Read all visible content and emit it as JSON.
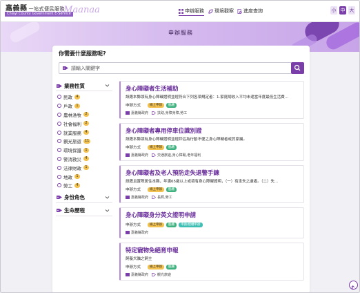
{
  "header": {
    "logo_title": "嘉義縣",
    "logo_subtitle": "一站式便民服務",
    "logo_en": "Chiayi County Government E-Service",
    "logo_script": "iMaanaa",
    "nav": [
      {
        "label": "申辦服務",
        "active": true,
        "icon": "grid-icon"
      },
      {
        "label": "環境觀察",
        "active": false,
        "icon": "leaf-icon"
      },
      {
        "label": "進度查詢",
        "active": false,
        "icon": "search-doc-icon"
      }
    ],
    "font_size": {
      "small": "小",
      "medium": "中",
      "large": "大"
    }
  },
  "banner": {
    "title": "申辦服務"
  },
  "search": {
    "question": "你需要什麼服務呢?",
    "placeholder": "請輸入關鍵字"
  },
  "sidebar": {
    "sections": [
      {
        "label": "業務性質",
        "expanded": true,
        "options": [
          {
            "label": "民政",
            "count": "4"
          },
          {
            "label": "戶政",
            "count": "1"
          },
          {
            "label": "農林漁牧",
            "count": "2"
          },
          {
            "label": "社會福利",
            "count": "2"
          },
          {
            "label": "就業服務",
            "count": "4"
          },
          {
            "label": "觀光旅遊",
            "count": "11"
          },
          {
            "label": "環境保護",
            "count": "1"
          },
          {
            "label": "警消救災",
            "count": "4"
          },
          {
            "label": "法律財政",
            "count": "1"
          },
          {
            "label": "地政",
            "count": "1"
          },
          {
            "label": "勞工",
            "count": "4"
          }
        ]
      },
      {
        "label": "身份角色",
        "expanded": false,
        "options": []
      },
      {
        "label": "生命歷程",
        "expanded": false,
        "options": []
      }
    ]
  },
  "results": [
    {
      "title": "身心障礙者生活補助",
      "desc": "設籍本縣領有身心障礙證明並經符合下列各項規定者：1.家庭總收入平均未達當年度最低生活費...",
      "method_label": "申辦方式",
      "chips": [
        {
          "text": "線上申辦",
          "color": "y"
        },
        {
          "text": "臨櫃",
          "color": "g"
        }
      ],
      "agency": "嘉義縣政府",
      "tags": "扶助,身障身障,勞工"
    },
    {
      "title": "身心障礙者專用停車位識別證",
      "desc": "設籍本縣領有身心障礙證明並經評估為行動不便之身心障礙者或其家屬。",
      "method_label": "申辦方式",
      "chips": [
        {
          "text": "線上申辦",
          "color": "y"
        },
        {
          "text": "臨櫃",
          "color": "g"
        }
      ],
      "agency": "嘉義縣政府",
      "tags": "交通旅遊,身心障礙,老年福利"
    },
    {
      "title": "身心障礙者及老人預防走失退警手鍊",
      "desc": "設籍且實際居住本縣，年滿65歲以上或領有身心障礙證明，（一）有走失之虞者。（二）失...",
      "method_label": "申辦方式",
      "chips": [
        {
          "text": "線上申辦",
          "color": "y"
        },
        {
          "text": "臨櫃",
          "color": "g"
        }
      ],
      "agency": "嘉義縣政府",
      "tags": "長照,勞工"
    },
    {
      "title": "身心障礙身分英文證明申請",
      "desc": "",
      "method_label": "申辦方式",
      "chips": [
        {
          "text": "線上申辦",
          "color": "y"
        },
        {
          "text": "臨櫃",
          "color": "g"
        },
        {
          "text": "申請/授權申辦",
          "color": "t"
        }
      ],
      "agency": "嘉義縣政府",
      "tags": ""
    },
    {
      "title": "特定寵物免絕育申報",
      "desc": "飼養犬貓之飼主",
      "method_label": "申辦方式",
      "chips": [
        {
          "text": "線上申辦",
          "color": "y"
        },
        {
          "text": "臨櫃",
          "color": "g"
        }
      ],
      "agency": "嘉義縣政府",
      "tags": "觀光旅遊"
    }
  ],
  "colors": {
    "primary": "#7a3ea8",
    "badge": "#f2c14f",
    "chip_green": "#3fb27f",
    "chip_teal": "#3fbfb4"
  }
}
